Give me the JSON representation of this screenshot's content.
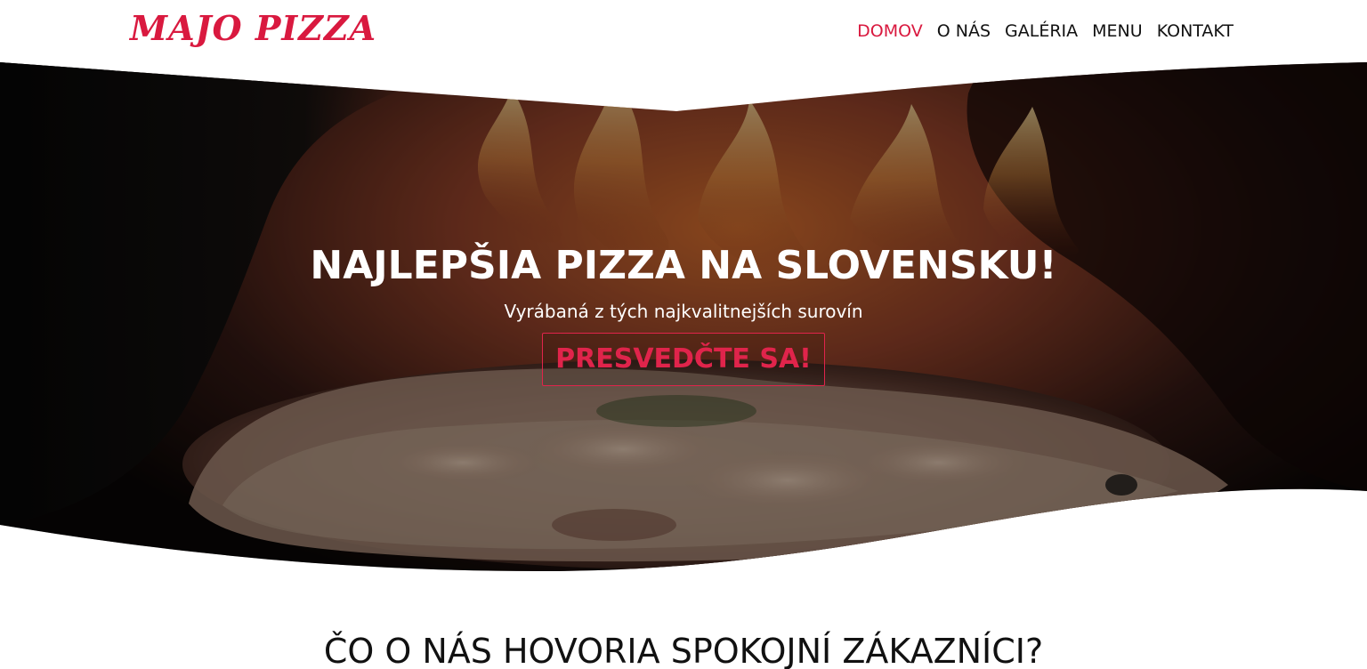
{
  "brand": {
    "logo_text": "MAJO PIZZA",
    "accent_color": "#d9193f"
  },
  "nav": {
    "items": [
      {
        "label": "DOMOV",
        "active": true
      },
      {
        "label": "O NÁS",
        "active": false
      },
      {
        "label": "GALÉRIA",
        "active": false
      },
      {
        "label": "MENU",
        "active": false
      },
      {
        "label": "KONTAKT",
        "active": false
      }
    ]
  },
  "hero": {
    "title": "NAJLEPŠIA PIZZA NA SLOVENSKU!",
    "subtitle": "Vyrábaná z tých najkvalitnejších surovín",
    "button_label": "PRESVEDČTE SA!",
    "background_image": "pizza-oven-image"
  },
  "section": {
    "heading": "ČO O NÁS HOVORIA SPOKOJNÍ ZÁKAZNÍCI?"
  }
}
